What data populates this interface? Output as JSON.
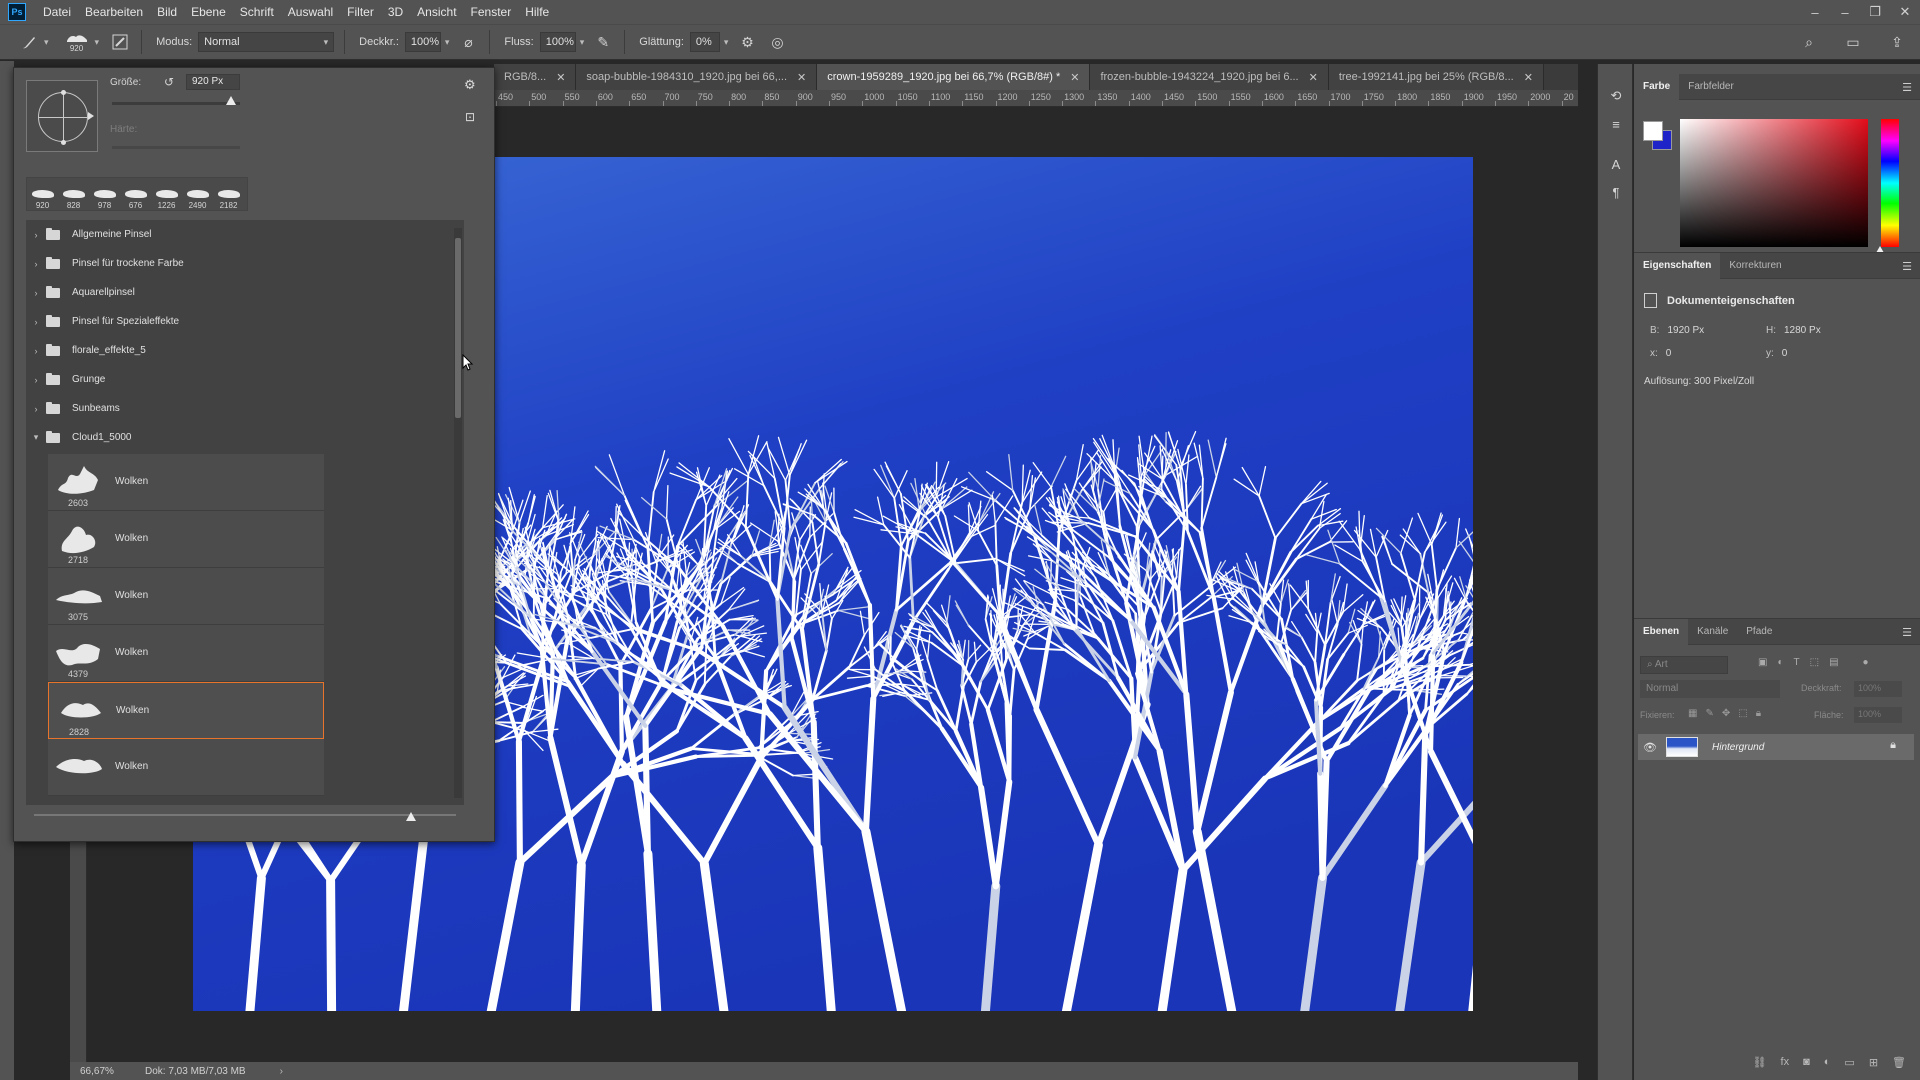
{
  "app": {
    "logo": "Ps"
  },
  "menu": [
    "Datei",
    "Bearbeiten",
    "Bild",
    "Ebene",
    "Schrift",
    "Auswahl",
    "Filter",
    "3D",
    "Ansicht",
    "Fenster",
    "Hilfe"
  ],
  "options": {
    "brush_size_badge": "920",
    "mode_label": "Modus:",
    "mode_value": "Normal",
    "opacity_label": "Deckkr.:",
    "opacity_value": "100%",
    "flow_label": "Fluss:",
    "flow_value": "100%",
    "smoothing_label": "Glättung:",
    "smoothing_value": "0%"
  },
  "tabs": [
    {
      "title": "RGB/8...",
      "active": false
    },
    {
      "title": "soap-bubble-1984310_1920.jpg bei 66,...",
      "active": false
    },
    {
      "title": "crown-1959289_1920.jpg bei 66,7% (RGB/8#) *",
      "active": true
    },
    {
      "title": "frozen-bubble-1943224_1920.jpg bei 6...",
      "active": false
    },
    {
      "title": "tree-1992141.jpg bei 25% (RGB/8...",
      "active": false
    }
  ],
  "ruler": [
    "450",
    "500",
    "550",
    "600",
    "650",
    "700",
    "750",
    "800",
    "850",
    "900",
    "950",
    "1000",
    "1050",
    "1100",
    "1150",
    "1200",
    "1250",
    "1300",
    "1350",
    "1400",
    "1450",
    "1500",
    "1550",
    "1600",
    "1650",
    "1700",
    "1750",
    "1800",
    "1850",
    "1900",
    "1950",
    "2000",
    "20"
  ],
  "status": {
    "zoom": "66,67%",
    "doc_size": "Dok: 7,03 MB/7,03 MB",
    "arrow": "›"
  },
  "brush_picker": {
    "size_label": "Größe:",
    "size_value": "920 Px",
    "hardness_label": "Härte:",
    "size_slider": 0.92,
    "recent": [
      "920",
      "828",
      "978",
      "676",
      "1226",
      "2490",
      "2182"
    ],
    "groups": [
      "Allgemeine Pinsel",
      "Pinsel für trockene Farbe",
      "Aquarellpinsel",
      "Pinsel für Spezialeffekte",
      "florale_effekte_5",
      "Grunge",
      "Sunbeams",
      "Cloud1_5000"
    ],
    "brushes": [
      {
        "size": "2603",
        "name": "Wolken"
      },
      {
        "size": "2718",
        "name": "Wolken"
      },
      {
        "size": "3075",
        "name": "Wolken"
      },
      {
        "size": "4379",
        "name": "Wolken"
      },
      {
        "size": "2828",
        "name": "Wolken",
        "selected": true
      },
      {
        "size": "",
        "name": "Wolken"
      }
    ]
  },
  "color_panel": {
    "tabs": [
      "Farbe",
      "Farbfelder"
    ],
    "foreground": "#ffffff",
    "background": "#1f24c8"
  },
  "properties_panel": {
    "tabs": [
      "Eigenschaften",
      "Korrekturen"
    ],
    "doc_title": "Dokumenteigenschaften",
    "width_key": "B:",
    "width_val": "1920 Px",
    "height_key": "H:",
    "height_val": "1280 Px",
    "x_key": "x:",
    "x_val": "0",
    "y_key": "y:",
    "y_val": "0",
    "resolution": "Auflösung: 300 Pixel/Zoll"
  },
  "layers_panel": {
    "tabs": [
      "Ebenen",
      "Kanäle",
      "Pfade"
    ],
    "filter_placeholder": "Art",
    "blend_mode": "Normal",
    "opacity_key": "Deckkraft:",
    "opacity_val": "100%",
    "fix_key": "Fixieren:",
    "fill_key": "Fläche:",
    "fill_val": "100%",
    "layers": [
      {
        "name": "Hintergrund"
      }
    ]
  },
  "colors": {
    "accent": "#e8742c",
    "ui_bg": "#535353",
    "canvas_bg": "#282828",
    "sky": "#1f3fc4"
  }
}
